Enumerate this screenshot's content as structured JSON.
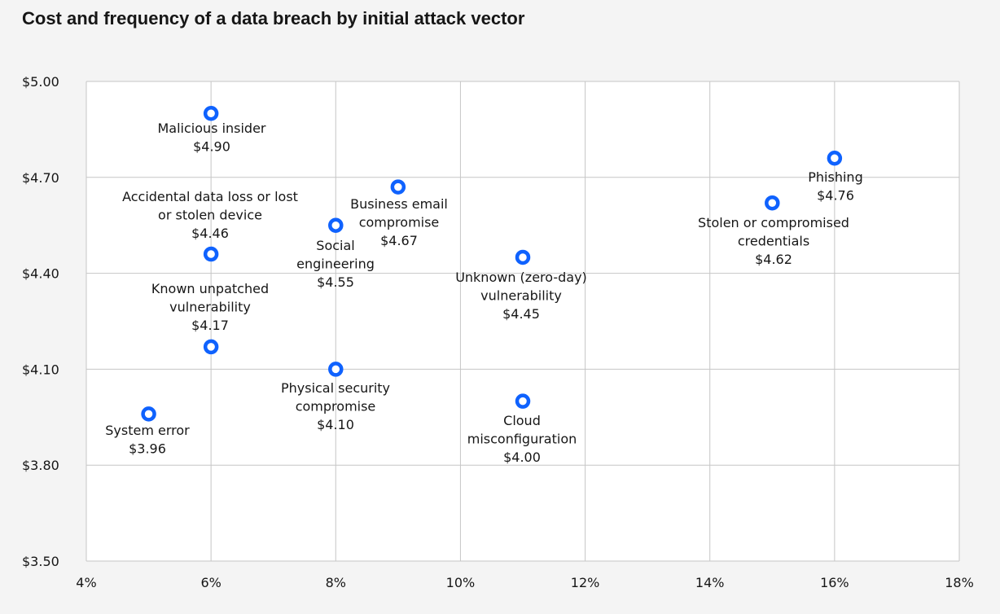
{
  "chart_data": {
    "type": "scatter",
    "title": "Cost and frequency of a data breach by initial attack vector",
    "xlabel": "",
    "ylabel": "",
    "xlim": [
      4,
      18
    ],
    "ylim": [
      3.5,
      5.0
    ],
    "x_ticks": [
      4,
      6,
      8,
      10,
      12,
      14,
      16,
      18
    ],
    "x_tick_labels": [
      "4%",
      "6%",
      "8%",
      "10%",
      "12%",
      "14%",
      "16%",
      "18%"
    ],
    "y_ticks": [
      3.5,
      3.8,
      4.1,
      4.4,
      4.7,
      5.0
    ],
    "y_tick_labels": [
      "$3.50",
      "$3.80",
      "$4.10",
      "$4.40",
      "$4.70",
      "$5.00"
    ],
    "grid": true,
    "marker_color": "#0f62fe",
    "points": [
      {
        "label": "Malicious insider",
        "value_label": "$4.90",
        "x": 6,
        "y": 4.9
      },
      {
        "label": "Accidental data loss or lost or stolen device",
        "value_label": "$4.46",
        "x": 6,
        "y": 4.46
      },
      {
        "label": "Known unpatched vulnerability",
        "value_label": "$4.17",
        "x": 6,
        "y": 4.17
      },
      {
        "label": "System error",
        "value_label": "$3.96",
        "x": 5,
        "y": 3.96
      },
      {
        "label": "Social engineering",
        "value_label": "$4.55",
        "x": 8,
        "y": 4.55
      },
      {
        "label": "Physical security compromise",
        "value_label": "$4.10",
        "x": 8,
        "y": 4.1
      },
      {
        "label": "Business email compromise",
        "value_label": "$4.67",
        "x": 9,
        "y": 4.67
      },
      {
        "label": "Unknown (zero-day) vulnerability",
        "value_label": "$4.45",
        "x": 11,
        "y": 4.45
      },
      {
        "label": "Cloud misconfiguration",
        "value_label": "$4.00",
        "x": 11,
        "y": 4.0
      },
      {
        "label": "Stolen or compromised credentials",
        "value_label": "$4.62",
        "x": 15,
        "y": 4.62
      },
      {
        "label": "Phishing",
        "value_label": "$4.76",
        "x": 16,
        "y": 4.76
      }
    ]
  }
}
